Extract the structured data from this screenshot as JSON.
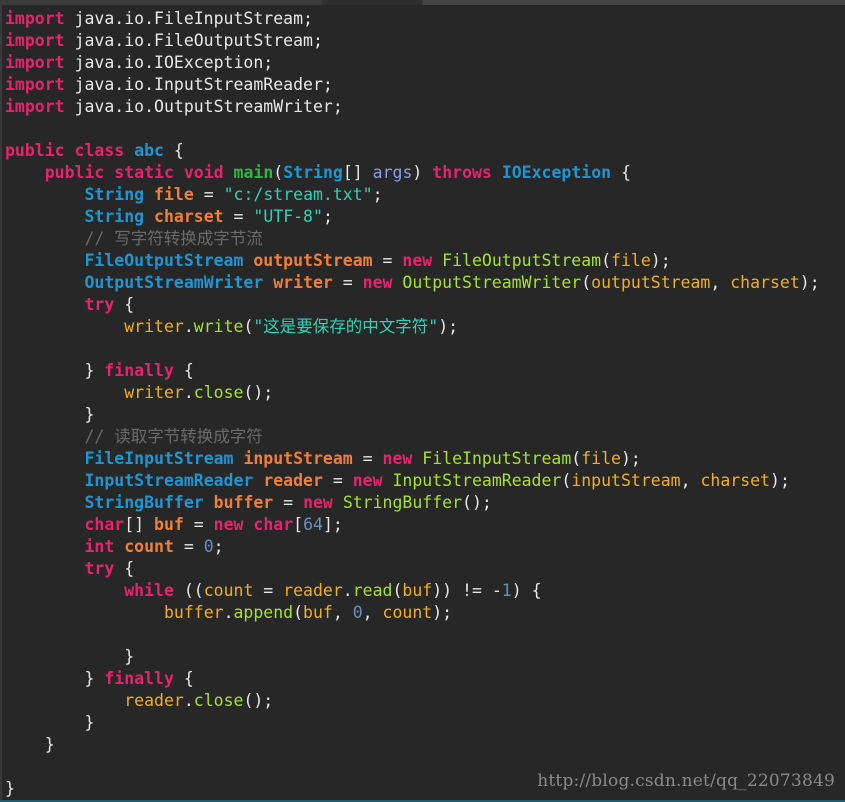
{
  "colors": {
    "background": "#272727",
    "keyword": "#e5246a",
    "type": "#1e96d4",
    "declared_variable": "#f07f3a",
    "variable": "#f0b020",
    "method": "#a6e22e",
    "main_method": "#2cb843",
    "string": "#2ed3b5",
    "comment": "#6a6a6a",
    "number": "#6a8fb8",
    "argument": "#8d9ce8"
  },
  "watermark": "http://blog.csdn.net/qq_22073849",
  "code_lines": [
    [
      [
        "kw",
        "import"
      ],
      [
        "pl",
        " java.io.FileInputStream;"
      ]
    ],
    [
      [
        "kw",
        "import"
      ],
      [
        "pl",
        " java.io.FileOutputStream;"
      ]
    ],
    [
      [
        "kw",
        "import"
      ],
      [
        "pl",
        " java.io.IOException;"
      ]
    ],
    [
      [
        "kw",
        "import"
      ],
      [
        "pl",
        " java.io.InputStreamReader;"
      ]
    ],
    [
      [
        "kw",
        "import"
      ],
      [
        "pl",
        " java.io.OutputStreamWriter;"
      ]
    ],
    [],
    [
      [
        "kw",
        "public"
      ],
      [
        "pl",
        " "
      ],
      [
        "kw",
        "class"
      ],
      [
        "pl",
        " "
      ],
      [
        "ty",
        "abc"
      ],
      [
        "pl",
        " {"
      ]
    ],
    [
      [
        "pl",
        "    "
      ],
      [
        "kw",
        "public"
      ],
      [
        "pl",
        " "
      ],
      [
        "kw",
        "static"
      ],
      [
        "pl",
        " "
      ],
      [
        "kw",
        "void"
      ],
      [
        "pl",
        " "
      ],
      [
        "mn",
        "main"
      ],
      [
        "pl",
        "("
      ],
      [
        "ty",
        "String"
      ],
      [
        "pl",
        "[] "
      ],
      [
        "ar",
        "args"
      ],
      [
        "pl",
        ") "
      ],
      [
        "kw",
        "throws"
      ],
      [
        "pl",
        " "
      ],
      [
        "ty",
        "IOException"
      ],
      [
        "pl",
        " {"
      ]
    ],
    [
      [
        "pl",
        "        "
      ],
      [
        "ty",
        "String"
      ],
      [
        "pl",
        " "
      ],
      [
        "dv",
        "file"
      ],
      [
        "pl",
        " = "
      ],
      [
        "st",
        "\"c:/stream.txt\""
      ],
      [
        "pl",
        ";"
      ]
    ],
    [
      [
        "pl",
        "        "
      ],
      [
        "ty",
        "String"
      ],
      [
        "pl",
        " "
      ],
      [
        "dv",
        "charset"
      ],
      [
        "pl",
        " = "
      ],
      [
        "st",
        "\"UTF-8\""
      ],
      [
        "pl",
        ";"
      ]
    ],
    [
      [
        "pl",
        "        "
      ],
      [
        "cm",
        "// 写字符转换成字节流"
      ]
    ],
    [
      [
        "pl",
        "        "
      ],
      [
        "ty",
        "FileOutputStream"
      ],
      [
        "pl",
        " "
      ],
      [
        "dv",
        "outputStream"
      ],
      [
        "pl",
        " = "
      ],
      [
        "kw",
        "new"
      ],
      [
        "pl",
        " "
      ],
      [
        "fn",
        "FileOutputStream"
      ],
      [
        "pl",
        "("
      ],
      [
        "va",
        "file"
      ],
      [
        "pl",
        ");"
      ]
    ],
    [
      [
        "pl",
        "        "
      ],
      [
        "ty",
        "OutputStreamWriter"
      ],
      [
        "pl",
        " "
      ],
      [
        "dv",
        "writer"
      ],
      [
        "pl",
        " = "
      ],
      [
        "kw",
        "new"
      ],
      [
        "pl",
        " "
      ],
      [
        "fn",
        "OutputStreamWriter"
      ],
      [
        "pl",
        "("
      ],
      [
        "va",
        "outputStream"
      ],
      [
        "pl",
        ", "
      ],
      [
        "va",
        "charset"
      ],
      [
        "pl",
        ");"
      ]
    ],
    [
      [
        "pl",
        "        "
      ],
      [
        "kw",
        "try"
      ],
      [
        "pl",
        " {"
      ]
    ],
    [
      [
        "pl",
        "            "
      ],
      [
        "va",
        "writer"
      ],
      [
        "pl",
        "."
      ],
      [
        "fn",
        "write"
      ],
      [
        "pl",
        "("
      ],
      [
        "st",
        "\"这是要保存的中文字符\""
      ],
      [
        "pl",
        ");"
      ]
    ],
    [],
    [
      [
        "pl",
        "        } "
      ],
      [
        "kw",
        "finally"
      ],
      [
        "pl",
        " {"
      ]
    ],
    [
      [
        "pl",
        "            "
      ],
      [
        "va",
        "writer"
      ],
      [
        "pl",
        "."
      ],
      [
        "fn",
        "close"
      ],
      [
        "pl",
        "();"
      ]
    ],
    [
      [
        "pl",
        "        }"
      ]
    ],
    [
      [
        "pl",
        "        "
      ],
      [
        "cm",
        "// 读取字节转换成字符"
      ]
    ],
    [
      [
        "pl",
        "        "
      ],
      [
        "ty",
        "FileInputStream"
      ],
      [
        "pl",
        " "
      ],
      [
        "dv",
        "inputStream"
      ],
      [
        "pl",
        " = "
      ],
      [
        "kw",
        "new"
      ],
      [
        "pl",
        " "
      ],
      [
        "fn",
        "FileInputStream"
      ],
      [
        "pl",
        "("
      ],
      [
        "va",
        "file"
      ],
      [
        "pl",
        ");"
      ]
    ],
    [
      [
        "pl",
        "        "
      ],
      [
        "ty",
        "InputStreamReader"
      ],
      [
        "pl",
        " "
      ],
      [
        "dv",
        "reader"
      ],
      [
        "pl",
        " = "
      ],
      [
        "kw",
        "new"
      ],
      [
        "pl",
        " "
      ],
      [
        "fn",
        "InputStreamReader"
      ],
      [
        "pl",
        "("
      ],
      [
        "va",
        "inputStream"
      ],
      [
        "pl",
        ", "
      ],
      [
        "va",
        "charset"
      ],
      [
        "pl",
        ");"
      ]
    ],
    [
      [
        "pl",
        "        "
      ],
      [
        "ty",
        "StringBuffer"
      ],
      [
        "pl",
        " "
      ],
      [
        "dv",
        "buffer"
      ],
      [
        "pl",
        " = "
      ],
      [
        "kw",
        "new"
      ],
      [
        "pl",
        " "
      ],
      [
        "fn",
        "StringBuffer"
      ],
      [
        "pl",
        "();"
      ]
    ],
    [
      [
        "pl",
        "        "
      ],
      [
        "kw",
        "char"
      ],
      [
        "pl",
        "[] "
      ],
      [
        "dv",
        "buf"
      ],
      [
        "pl",
        " = "
      ],
      [
        "kw",
        "new"
      ],
      [
        "pl",
        " "
      ],
      [
        "kw",
        "char"
      ],
      [
        "pl",
        "["
      ],
      [
        "nu",
        "64"
      ],
      [
        "pl",
        "];"
      ]
    ],
    [
      [
        "pl",
        "        "
      ],
      [
        "kw",
        "int"
      ],
      [
        "pl",
        " "
      ],
      [
        "dv",
        "count"
      ],
      [
        "pl",
        " = "
      ],
      [
        "nu",
        "0"
      ],
      [
        "pl",
        ";"
      ]
    ],
    [
      [
        "pl",
        "        "
      ],
      [
        "kw",
        "try"
      ],
      [
        "pl",
        " {"
      ]
    ],
    [
      [
        "pl",
        "            "
      ],
      [
        "kw",
        "while"
      ],
      [
        "pl",
        " (("
      ],
      [
        "va",
        "count"
      ],
      [
        "pl",
        " = "
      ],
      [
        "va",
        "reader"
      ],
      [
        "pl",
        "."
      ],
      [
        "fn",
        "read"
      ],
      [
        "pl",
        "("
      ],
      [
        "va",
        "buf"
      ],
      [
        "pl",
        ")) != -"
      ],
      [
        "nu",
        "1"
      ],
      [
        "pl",
        ") {"
      ]
    ],
    [
      [
        "pl",
        "                "
      ],
      [
        "va",
        "buffer"
      ],
      [
        "pl",
        "."
      ],
      [
        "fn",
        "append"
      ],
      [
        "pl",
        "("
      ],
      [
        "va",
        "buf"
      ],
      [
        "pl",
        ", "
      ],
      [
        "nu",
        "0"
      ],
      [
        "pl",
        ", "
      ],
      [
        "va",
        "count"
      ],
      [
        "pl",
        ");"
      ]
    ],
    [],
    [
      [
        "pl",
        "            }"
      ]
    ],
    [
      [
        "pl",
        "        } "
      ],
      [
        "kw",
        "finally"
      ],
      [
        "pl",
        " {"
      ]
    ],
    [
      [
        "pl",
        "            "
      ],
      [
        "va",
        "reader"
      ],
      [
        "pl",
        "."
      ],
      [
        "fn",
        "close"
      ],
      [
        "pl",
        "();"
      ]
    ],
    [
      [
        "pl",
        "        }"
      ]
    ],
    [
      [
        "pl",
        "    }"
      ]
    ],
    [],
    [
      [
        "pl",
        "}"
      ]
    ]
  ]
}
